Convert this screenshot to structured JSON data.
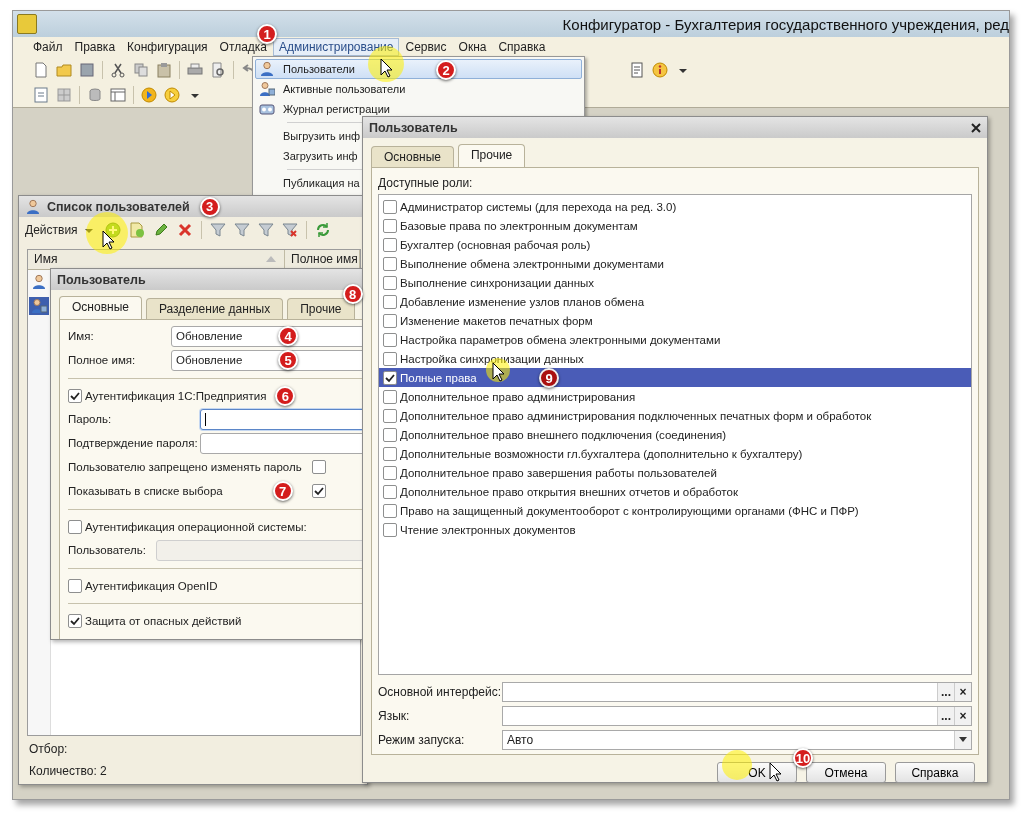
{
  "window": {
    "title": "Конфигуратор - Бухгалтерия государственного учреждения, ред"
  },
  "menu": [
    {
      "label": "Файл",
      "selected": false
    },
    {
      "label": "Правка",
      "selected": false
    },
    {
      "label": "Конфигурация",
      "selected": false
    },
    {
      "label": "Отладка",
      "selected": false
    },
    {
      "label": "Администрирование",
      "selected": true,
      "badge": "1"
    },
    {
      "label": "Сервис",
      "selected": false
    },
    {
      "label": "Окна",
      "selected": false
    },
    {
      "label": "Справка",
      "selected": false
    }
  ],
  "admin_menu": [
    {
      "kind": "item",
      "label": "Пользователи",
      "selected": true,
      "badge": "2"
    },
    {
      "kind": "item",
      "label": "Активные пользователи",
      "selected": false
    },
    {
      "kind": "item",
      "label": "Журнал регистрации",
      "selected": false
    },
    {
      "kind": "separator"
    },
    {
      "kind": "item",
      "label": "Выгрузить инф",
      "selected": false
    },
    {
      "kind": "item",
      "label": "Загрузить инф",
      "selected": false
    },
    {
      "kind": "separator"
    },
    {
      "kind": "item",
      "label": "Публикация на",
      "selected": false
    }
  ],
  "users_window": {
    "title": "Список пользователей",
    "badge": "3",
    "actions": "Действия",
    "columns": [
      "Имя",
      "Полное имя"
    ],
    "rows": [
      {
        "selected": false
      },
      {
        "selected": true
      }
    ],
    "filter_label": "Отбор:",
    "count": "Количество: 2"
  },
  "user_form": {
    "title": "Пользователь",
    "tabs": [
      {
        "label": "Основные",
        "selected": true
      },
      {
        "label": "Разделение данных",
        "selected": false
      },
      {
        "label": "Прочие",
        "selected": false,
        "badge": "8"
      }
    ],
    "name_fields": [
      {
        "label": "Имя:",
        "value": "Обновление",
        "badge": "4"
      },
      {
        "label": "Полное имя:",
        "value": "Обновление",
        "badge": "5"
      }
    ],
    "auth_1c": {
      "label": "Аутентификация 1С:Предприятия",
      "checked": true,
      "badge": "6",
      "fields": [
        {
          "label": "Пароль:",
          "focused": true
        },
        {
          "label": "Подтверждение пароля:",
          "focused": false
        }
      ],
      "options": [
        {
          "label": "Пользователю запрещено изменять пароль",
          "checked": false
        },
        {
          "label": "Показывать в списке выбора",
          "checked": true,
          "badge": "7"
        }
      ]
    },
    "auth_os": {
      "label": "Аутентификация операционной системы:",
      "checked": false,
      "fields": [
        {
          "label": "Пользователь:",
          "disabled": true
        }
      ]
    },
    "auth_openid": {
      "label": "Аутентификация OpenID",
      "checked": false
    },
    "protection": {
      "label": "Защита от опасных действий",
      "checked": true
    }
  },
  "role_dialog": {
    "title": "Пользователь",
    "tabs": [
      {
        "label": "Основные",
        "selected": false
      },
      {
        "label": "Прочие",
        "selected": true
      }
    ],
    "roles_label": "Доступные роли:",
    "roles": [
      {
        "label": "Администратор системы (для перехода на ред. 3.0)",
        "checked": false,
        "selected": false
      },
      {
        "label": "Базовые права по электронным документам",
        "checked": false,
        "selected": false
      },
      {
        "label": "Бухгалтер (основная рабочая роль)",
        "checked": false,
        "selected": false
      },
      {
        "label": "Выполнение обмена электронными документами",
        "checked": false,
        "selected": false
      },
      {
        "label": "Выполнение синхронизации данных",
        "checked": false,
        "selected": false
      },
      {
        "label": "Добавление изменение узлов планов обмена",
        "checked": false,
        "selected": false
      },
      {
        "label": "Изменение макетов печатных форм",
        "checked": false,
        "selected": false
      },
      {
        "label": "Настройка параметров обмена электронными документами",
        "checked": false,
        "selected": false
      },
      {
        "label": "Настройка синхронизации данных",
        "checked": false,
        "selected": false
      },
      {
        "label": "Полные права",
        "checked": true,
        "selected": true,
        "badge": "9"
      },
      {
        "label": "Дополнительное право администрирования",
        "checked": false,
        "selected": false
      },
      {
        "label": "Дополнительное право администрирования подключенных печатных форм и обработок",
        "checked": false,
        "selected": false
      },
      {
        "label": "Дополнительное право внешнего подключения (соединения)",
        "checked": false,
        "selected": false
      },
      {
        "label": "Дополнительные возможности гл.бухгалтера (дополнительно к бухгалтеру)",
        "checked": false,
        "selected": false
      },
      {
        "label": "Дополнительное право завершения работы пользователей",
        "checked": false,
        "selected": false
      },
      {
        "label": "Дополнительное право открытия внешних отчетов и обработок",
        "checked": false,
        "selected": false
      },
      {
        "label": "Право на защищенный документооборот с контролирующими органами (ФНС и ПФР)",
        "checked": false,
        "selected": false
      },
      {
        "label": "Чтение электронных документов",
        "checked": false,
        "selected": false
      }
    ],
    "fields": [
      {
        "label": "Основной интерфейс:",
        "kind": "choice",
        "buttons": [
          "...",
          "×"
        ]
      },
      {
        "label": "Язык:",
        "kind": "choice",
        "buttons": [
          "...",
          "×"
        ]
      },
      {
        "label": "Режим запуска:",
        "kind": "dropdown",
        "value": "Авто"
      }
    ],
    "buttons": [
      {
        "label": "OK",
        "badge": "10"
      },
      {
        "label": "Отмена"
      },
      {
        "label": "Справка"
      }
    ]
  }
}
